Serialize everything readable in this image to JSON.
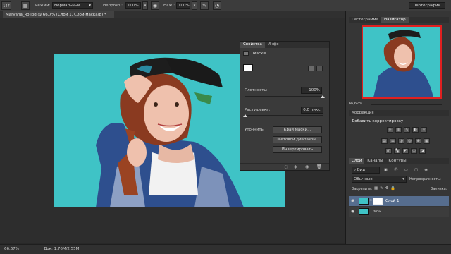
{
  "options_bar": {
    "tool_size": "147",
    "mode_label": "Режим:",
    "mode_value": "Нормальный",
    "opacity_label": "Непрозр.:",
    "opacity_value": "100%",
    "pressure_label": "Наж.:",
    "pressure_value": "100%",
    "workspace": "Фотографии"
  },
  "document": {
    "tab_title": "Maryana_Ro.jpg @ 66,7% (Слой 1, Слой-маска/8) *"
  },
  "properties": {
    "tabs": [
      "Свойства",
      "Инфо"
    ],
    "section": "Маски",
    "density_label": "Плотность:",
    "density_value": "100%",
    "feather_label": "Растушевка:",
    "feather_value": "0,0 пикс.",
    "refine_label": "Уточнить:",
    "btn_mask_edge": "Край маски...",
    "btn_color_range": "Цветовой диапазон...",
    "btn_invert": "Инвертировать"
  },
  "navigator": {
    "tabs": [
      "Гистограмма",
      "Навигатор"
    ],
    "zoom": "66,67%"
  },
  "adjustments": {
    "title": "Коррекция",
    "subtitle": "Добавить корректировку"
  },
  "layers": {
    "tabs": [
      "Слои",
      "Каналы",
      "Контуры"
    ],
    "kind_label": "Вид",
    "blend_value": "Обычные",
    "opacity_label": "Непрозрачность:",
    "lock_label": "Закрепить:",
    "fill_label": "Заливка:",
    "items": [
      {
        "name": "Слой 1"
      },
      {
        "name": "Фон"
      }
    ]
  },
  "status": {
    "zoom": "66,67%",
    "doc_info": "Док: 1,76M/2,55M"
  },
  "colors": {
    "accent_tab": "#4a4a4a",
    "photo_bg": "#3fc3c6",
    "nav_frame": "#e02020"
  }
}
